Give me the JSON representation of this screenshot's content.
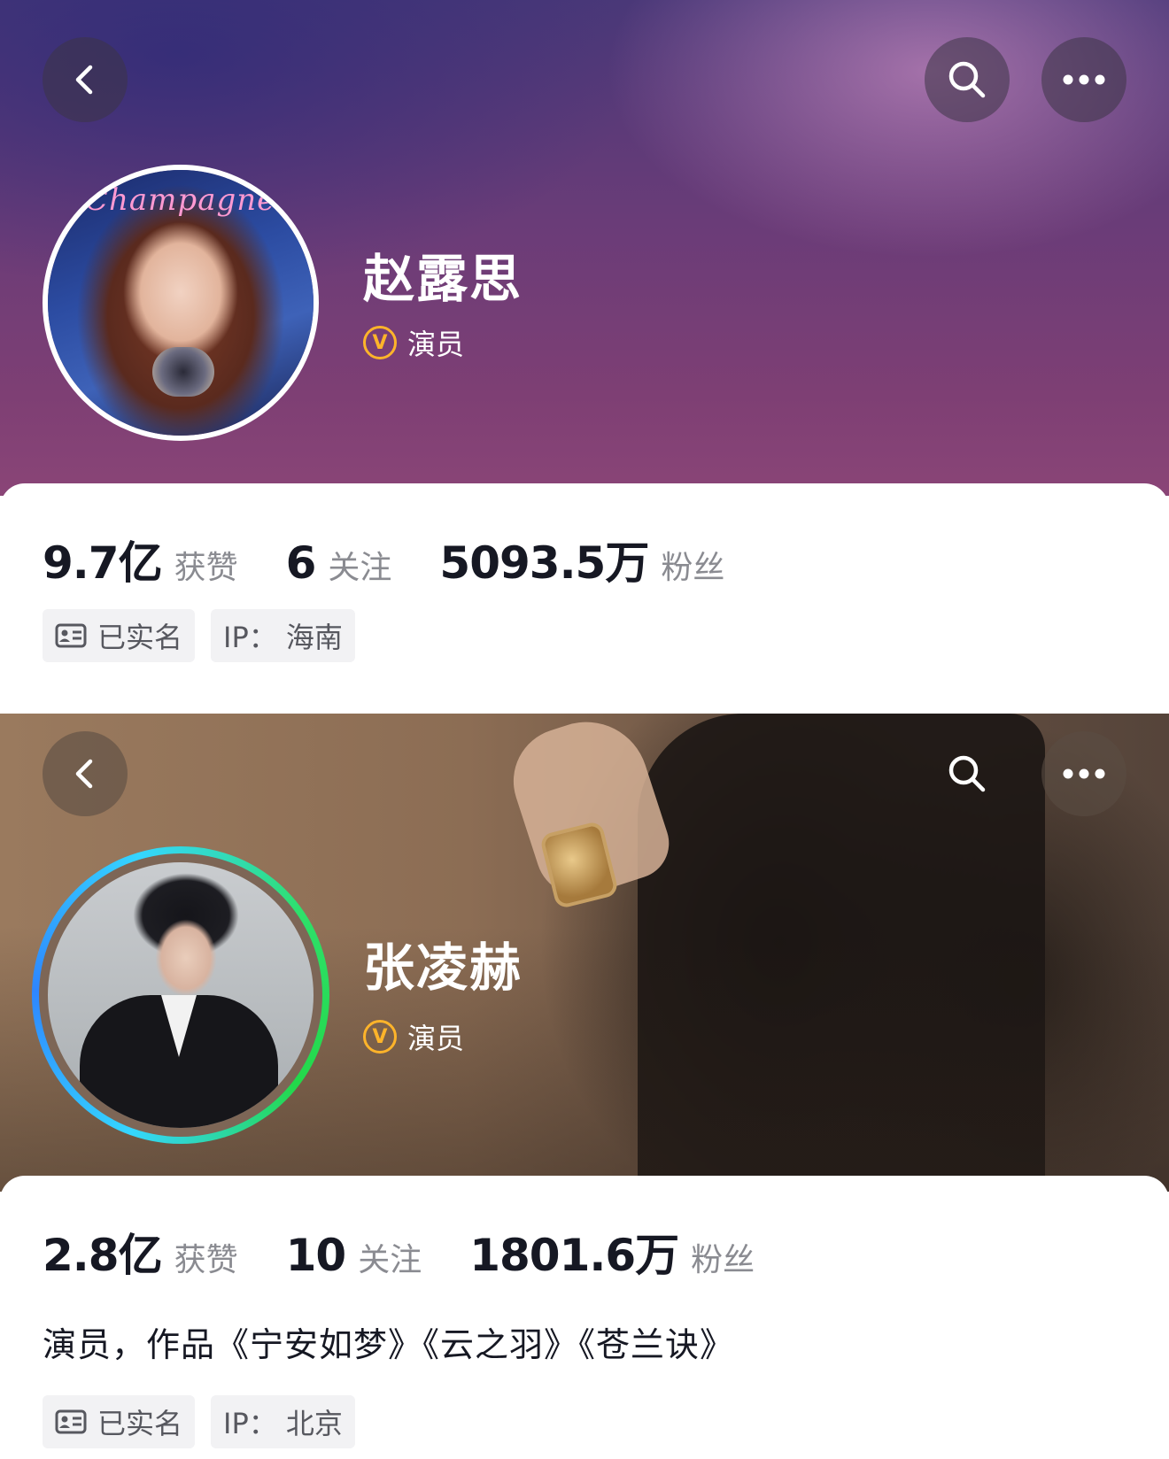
{
  "profiles": [
    {
      "name": "赵露思",
      "verify_badge": "V",
      "verify_text": "演员",
      "avatar_text": "Champagne",
      "stats": [
        {
          "value": "9.7亿",
          "label": "获赞"
        },
        {
          "value": "6",
          "label": "关注"
        },
        {
          "value": "5093.5万",
          "label": "粉丝"
        }
      ],
      "tags": [
        {
          "icon": "id-card-icon",
          "label": "已实名"
        },
        {
          "label": "IP： 海南"
        }
      ],
      "buttons": {
        "back": "back-icon",
        "search": "search-icon",
        "more": "more-icon"
      }
    },
    {
      "name": "张凌赫",
      "verify_badge": "V",
      "verify_text": "演员",
      "stats": [
        {
          "value": "2.8亿",
          "label": "获赞"
        },
        {
          "value": "10",
          "label": "关注"
        },
        {
          "value": "1801.6万",
          "label": "粉丝"
        }
      ],
      "bio": "演员，作品《宁安如梦》《云之羽》《苍兰诀》",
      "tags": [
        {
          "icon": "id-card-icon",
          "label": "已实名"
        },
        {
          "label": "IP： 北京"
        }
      ],
      "buttons": {
        "back": "back-icon",
        "search": "search-icon",
        "more": "more-icon"
      }
    }
  ],
  "colors": {
    "verify": "#ffb42a",
    "text_primary": "#161823",
    "text_secondary": "#8a8b91",
    "tag_bg": "#f2f2f4",
    "live_ring_start": "#2e86ff",
    "live_ring_end": "#23d84a"
  }
}
